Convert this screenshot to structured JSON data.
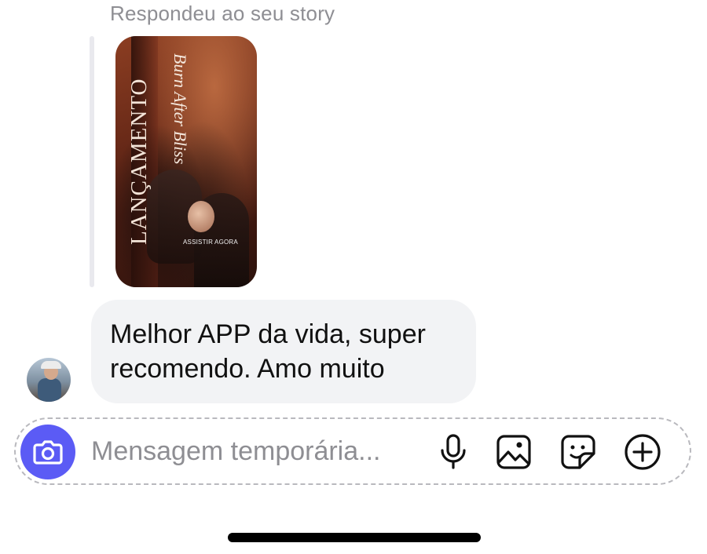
{
  "reply": {
    "header": "Respondeu ao seu story"
  },
  "story": {
    "vertical_title": "LANÇAMENTO",
    "movie_title": "Burn After Bliss",
    "cta": "ASSISTIR AGORA"
  },
  "message": {
    "text": "Melhor APP da vida, super recomendo. Amo muito"
  },
  "composer": {
    "placeholder": "Mensagem temporária..."
  },
  "icons": {
    "camera": "camera-icon",
    "mic": "microphone-icon",
    "gallery": "image-icon",
    "sticker": "sticker-icon",
    "add": "plus-circle-icon"
  },
  "colors": {
    "accent": "#5b5bf5",
    "bubble": "#f2f3f5",
    "muted_text": "#8e8e93"
  }
}
